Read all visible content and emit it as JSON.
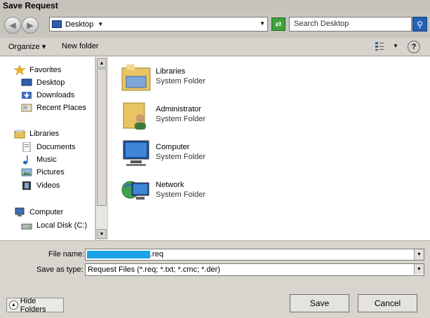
{
  "window": {
    "title": "Save Request"
  },
  "address": {
    "location": "Desktop"
  },
  "search": {
    "placeholder": "Search Desktop"
  },
  "toolbar": {
    "organize": "Organize",
    "new_folder": "New folder"
  },
  "nav": {
    "groups": [
      {
        "label": "Favorites",
        "icon": "star-icon",
        "items": [
          {
            "label": "Desktop",
            "icon": "desktop-icon"
          },
          {
            "label": "Downloads",
            "icon": "downloads-icon"
          },
          {
            "label": "Recent Places",
            "icon": "recent-places-icon"
          }
        ]
      },
      {
        "label": "Libraries",
        "icon": "libraries-icon",
        "items": [
          {
            "label": "Documents",
            "icon": "documents-icon"
          },
          {
            "label": "Music",
            "icon": "music-icon"
          },
          {
            "label": "Pictures",
            "icon": "pictures-icon"
          },
          {
            "label": "Videos",
            "icon": "videos-icon"
          }
        ]
      },
      {
        "label": "Computer",
        "icon": "computer-icon",
        "items": [
          {
            "label": "Local Disk (C:)",
            "icon": "disk-icon"
          }
        ]
      }
    ]
  },
  "content": {
    "items": [
      {
        "name": "Libraries",
        "type": "System Folder",
        "icon": "libraries-folder-icon"
      },
      {
        "name": "Administrator",
        "type": "System Folder",
        "icon": "user-folder-icon"
      },
      {
        "name": "Computer",
        "type": "System Folder",
        "icon": "computer-icon"
      },
      {
        "name": "Network",
        "type": "System Folder",
        "icon": "network-icon"
      }
    ]
  },
  "form": {
    "file_name_label": "File name:",
    "file_name_value": ".req",
    "save_type_label": "Save as type:",
    "save_type_value": "Request Files (*.req; *.txt; *.cmc; *.der)"
  },
  "buttons": {
    "hide_folders": "Hide Folders",
    "save": "Save",
    "cancel": "Cancel"
  },
  "colors": {
    "selection": "#1aa3e6",
    "window_bg": "#d4d0c8"
  }
}
